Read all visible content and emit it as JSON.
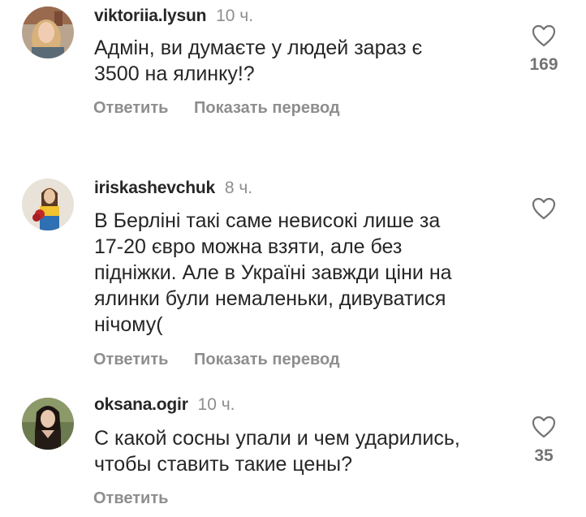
{
  "comments": [
    {
      "username": "viktoriia.lysun",
      "time": "10 ч.",
      "lines": [
        "Адмін, ви думаєте у людей зараз є",
        "3500 на ялинку!?"
      ],
      "reply_label": "Ответить",
      "translate_label": "Показать перевод",
      "likes": "169",
      "avatar_icon": "profile-photo"
    },
    {
      "username": "iriskashevchuk",
      "time": "8 ч.",
      "lines": [
        "В Берліні такі саме невисокі лише за",
        "17-20 євро можна взяти, але без",
        "підніжки. Але в Україні завжди ціни на",
        "ялинки були немаленьки, дивуватися",
        "нічому("
      ],
      "reply_label": "Ответить",
      "translate_label": "Показать перевод",
      "likes": "",
      "avatar_icon": "profile-photo"
    },
    {
      "username": "oksana.ogir",
      "time": "10 ч.",
      "lines": [
        "С какой сосны упали и чем ударились,",
        "чтобы ставить такие цены?"
      ],
      "reply_label": "Ответить",
      "likes": "35",
      "avatar_icon": "profile-photo"
    }
  ],
  "colors": {
    "text": "#262626",
    "secondary": "#8e8e8e",
    "background": "#ffffff"
  },
  "icons": {
    "like": "heart-outline-icon"
  }
}
